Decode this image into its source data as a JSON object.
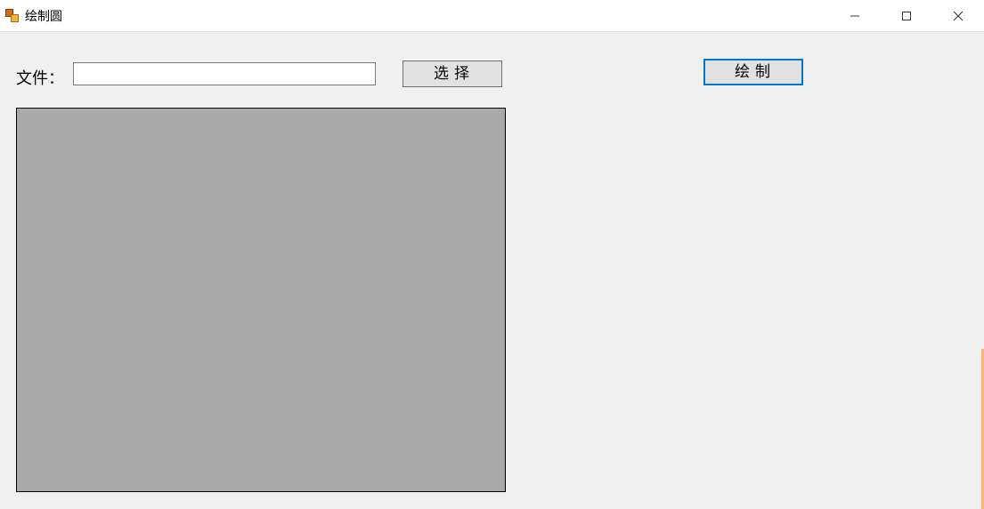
{
  "window": {
    "title": "绘制圆"
  },
  "form": {
    "file_label": "文件：",
    "file_value": "",
    "select_button": "选择",
    "draw_button": "绘制"
  }
}
